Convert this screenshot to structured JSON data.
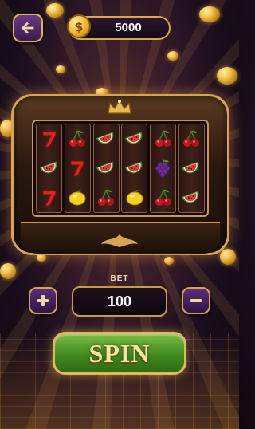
{
  "header": {
    "back_icon": "arrow-left-icon",
    "balance_icon": "dollar-coin-icon",
    "balance_symbol": "$",
    "balance": "5000"
  },
  "reels": [
    [
      "seven",
      "watermelon",
      "seven"
    ],
    [
      "cherry",
      "seven",
      "lemon"
    ],
    [
      "watermelon",
      "watermelon",
      "cherry"
    ],
    [
      "watermelon",
      "watermelon",
      "lemon"
    ],
    [
      "cherry",
      "grape",
      "cherry"
    ],
    [
      "cherry",
      "watermelon",
      "watermelon"
    ]
  ],
  "bet": {
    "label": "BET",
    "value": "100",
    "increase_icon": "plus-icon",
    "decrease_icon": "minus-icon"
  },
  "spin": {
    "label": "SPIN"
  },
  "colors": {
    "gold": "#d6a552",
    "spin_green": "#3f8a1e",
    "button_purple": "#5a2e7a"
  }
}
